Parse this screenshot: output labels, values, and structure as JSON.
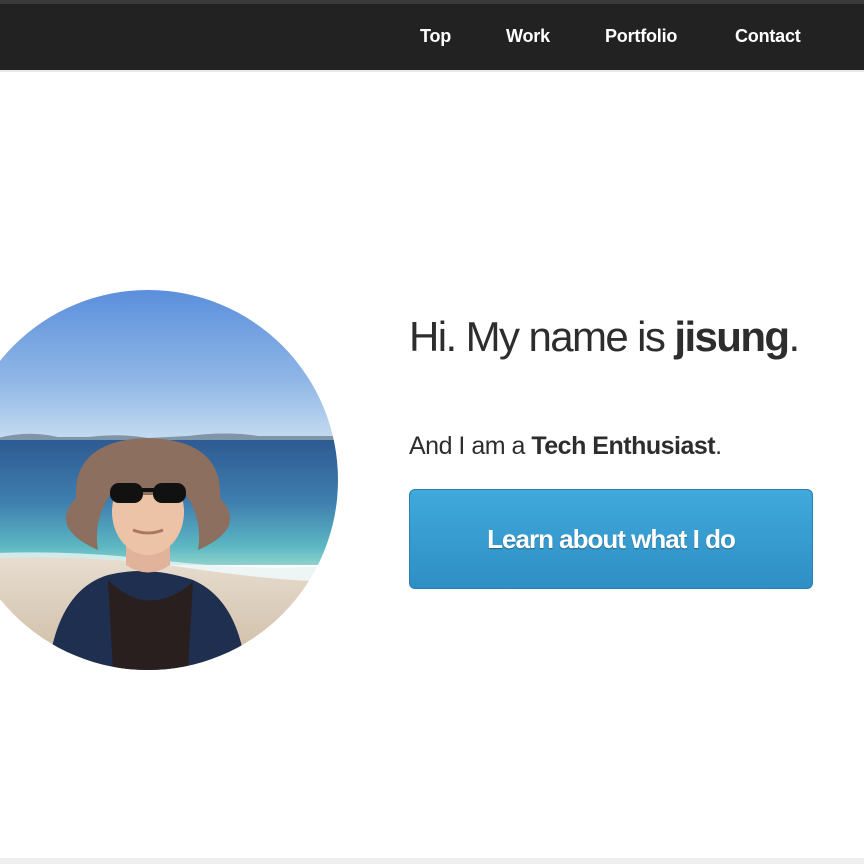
{
  "nav": {
    "items": [
      {
        "label": "Top"
      },
      {
        "label": "Work"
      },
      {
        "label": "Portfolio"
      },
      {
        "label": "Contact"
      }
    ]
  },
  "hero": {
    "headline_prefix": "Hi. My name is ",
    "headline_name": "jisung",
    "headline_suffix": ".",
    "tagline_prefix": "And I am a ",
    "tagline_role": "Tech Enthusiast",
    "tagline_suffix": ".",
    "cta_label": "Learn about what I do"
  },
  "colors": {
    "navbar": "#222222",
    "text": "#2d2d2d",
    "button": "#3aa0d3"
  }
}
